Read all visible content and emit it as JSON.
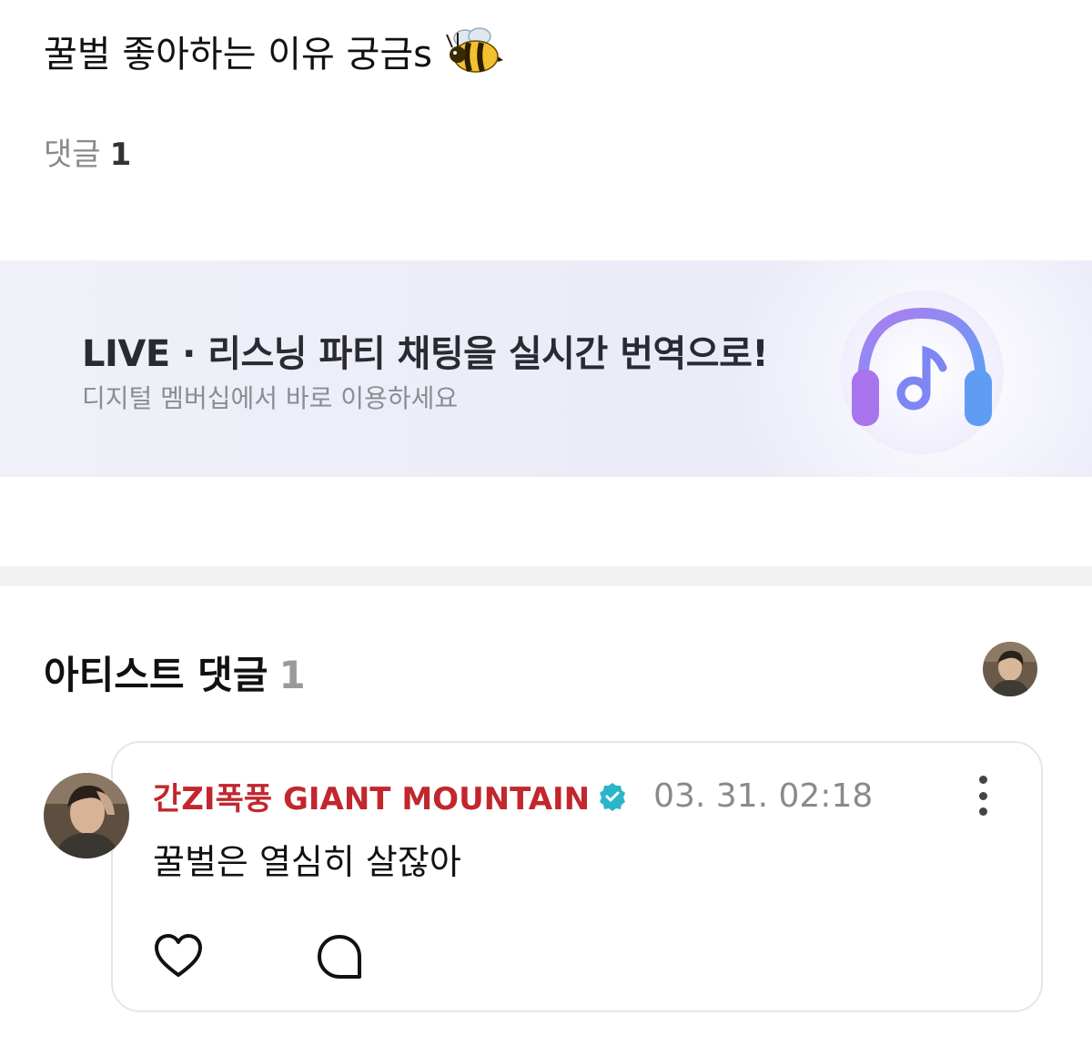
{
  "post": {
    "text": "꿀벌 좋아하는 이유 궁금s",
    "emoji_icon": "bee-icon"
  },
  "comments_summary": {
    "label": "댓글",
    "count": "1"
  },
  "banner": {
    "title": "LIVE · 리스닝 파티 채팅을 실시간 번역으로!",
    "subtitle": "디지털 멤버십에서 바로 이용하세요",
    "icon": "headphone-music-icon"
  },
  "artist_comments": {
    "title": "아티스트 댓글",
    "count": "1"
  },
  "comment": {
    "author": "간ZI폭풍 GIANT MOUNTAIN",
    "timestamp": "03. 31. 02:18",
    "body": "꿀벌은 열심히 살잖아",
    "verified_icon": "verified-badge-icon",
    "more_icon": "more-vertical-icon",
    "like_icon": "heart-icon",
    "reply_icon": "comment-bubble-icon"
  },
  "colors": {
    "author": "#c1272d",
    "verified": "#2bb5c9",
    "banner_bg": "#ececf8"
  }
}
